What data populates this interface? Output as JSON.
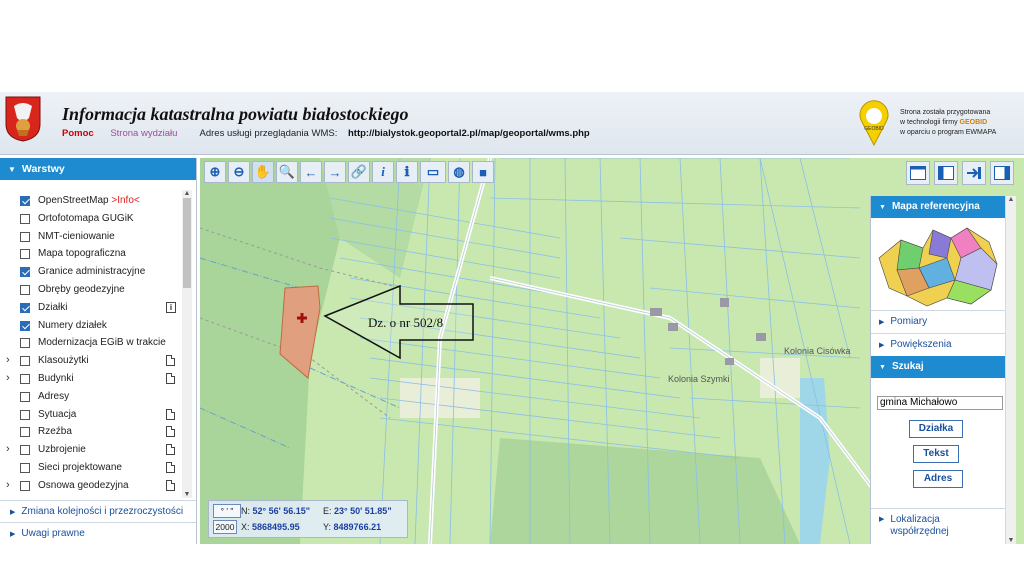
{
  "header": {
    "title": "Informacja katastralna powiatu białostockiego",
    "help_link": "Pomoc",
    "dept_link": "Strona wydziału",
    "wms_label": "Adres usługi przeglądania WMS:",
    "wms_url": "http://bialystok.geoportal2.pl/map/geoportal/wms.php",
    "vendor_line1": "Strona została przygotowana",
    "vendor_line2_prefix": "w technologii firmy ",
    "vendor_name": "GEOBID",
    "vendor_line3": "w oparciu o program EWMAPA",
    "logo_text": "GEOBID"
  },
  "layers_panel": {
    "title": "Warstwy",
    "items": [
      {
        "label": "OpenStreetMap ",
        "extra": ">Info<",
        "checked": true,
        "expandable": false,
        "icon": ""
      },
      {
        "label": "Ortofotomapa GUGiK",
        "extra": "",
        "checked": false,
        "expandable": false,
        "icon": ""
      },
      {
        "label": "NMT-cieniowanie",
        "extra": "",
        "checked": false,
        "expandable": false,
        "icon": ""
      },
      {
        "label": "Mapa topograficzna",
        "extra": "",
        "checked": false,
        "expandable": false,
        "icon": ""
      },
      {
        "label": "Granice administracyjne",
        "extra": "",
        "checked": true,
        "expandable": false,
        "icon": ""
      },
      {
        "label": "Obręby geodezyjne",
        "extra": "",
        "checked": false,
        "expandable": false,
        "icon": ""
      },
      {
        "label": "Działki",
        "extra": "",
        "checked": true,
        "expandable": false,
        "icon": "info-doc-icon"
      },
      {
        "label": "Numery działek",
        "extra": "",
        "checked": true,
        "expandable": false,
        "icon": ""
      },
      {
        "label": "Modernizacja EGiB w trakcie",
        "extra": "",
        "checked": false,
        "expandable": false,
        "icon": ""
      },
      {
        "label": "Klasoużytki",
        "extra": "",
        "checked": false,
        "expandable": true,
        "icon": "doc-icon"
      },
      {
        "label": "Budynki",
        "extra": "",
        "checked": false,
        "expandable": true,
        "icon": "doc-icon"
      },
      {
        "label": "Adresy",
        "extra": "",
        "checked": false,
        "expandable": false,
        "icon": ""
      },
      {
        "label": "Sytuacja",
        "extra": "",
        "checked": false,
        "expandable": false,
        "icon": "doc-icon"
      },
      {
        "label": "Rzeźba",
        "extra": "",
        "checked": false,
        "expandable": false,
        "icon": "doc-icon"
      },
      {
        "label": "Uzbrojenie",
        "extra": "",
        "checked": false,
        "expandable": true,
        "icon": "doc-icon"
      },
      {
        "label": "Sieci projektowane",
        "extra": "",
        "checked": false,
        "expandable": false,
        "icon": "doc-icon"
      },
      {
        "label": "Osnowa geodezyjna",
        "extra": "",
        "checked": false,
        "expandable": true,
        "icon": "doc-icon"
      }
    ],
    "order_section": "Zmiana kolejności i przezroczystości",
    "legal_section": "Uwagi prawne"
  },
  "map": {
    "annotation": "Dz. o nr 502/8",
    "village1": "Kolonia Szymki",
    "village2": "Kolonia Cisówka"
  },
  "coords": {
    "format_btn": "° ' \"",
    "epsg_btn": "2000",
    "n_label": "N:",
    "n_value": "52° 56' 56.15\"",
    "e_label": "E:",
    "e_value": "23° 50' 51.85\"",
    "x_label": "X:",
    "x_value": "5868495.95",
    "y_label": "Y:",
    "y_value": "8489766.21"
  },
  "right_panel": {
    "ref_map": "Mapa referencyjna",
    "measure": "Pomiary",
    "zoom": "Powiększenia",
    "search": "Szukaj",
    "search_value": "gmina Michałowo",
    "btn_parcel": "Działka",
    "btn_text": "Tekst",
    "btn_address": "Adres",
    "locate": "Lokalizacja współrzędnej"
  },
  "colors": {
    "accent": "#1e8bd1",
    "map_field": "#b9e0a4",
    "parcel": "#e0a080",
    "help": "#cc0000"
  }
}
